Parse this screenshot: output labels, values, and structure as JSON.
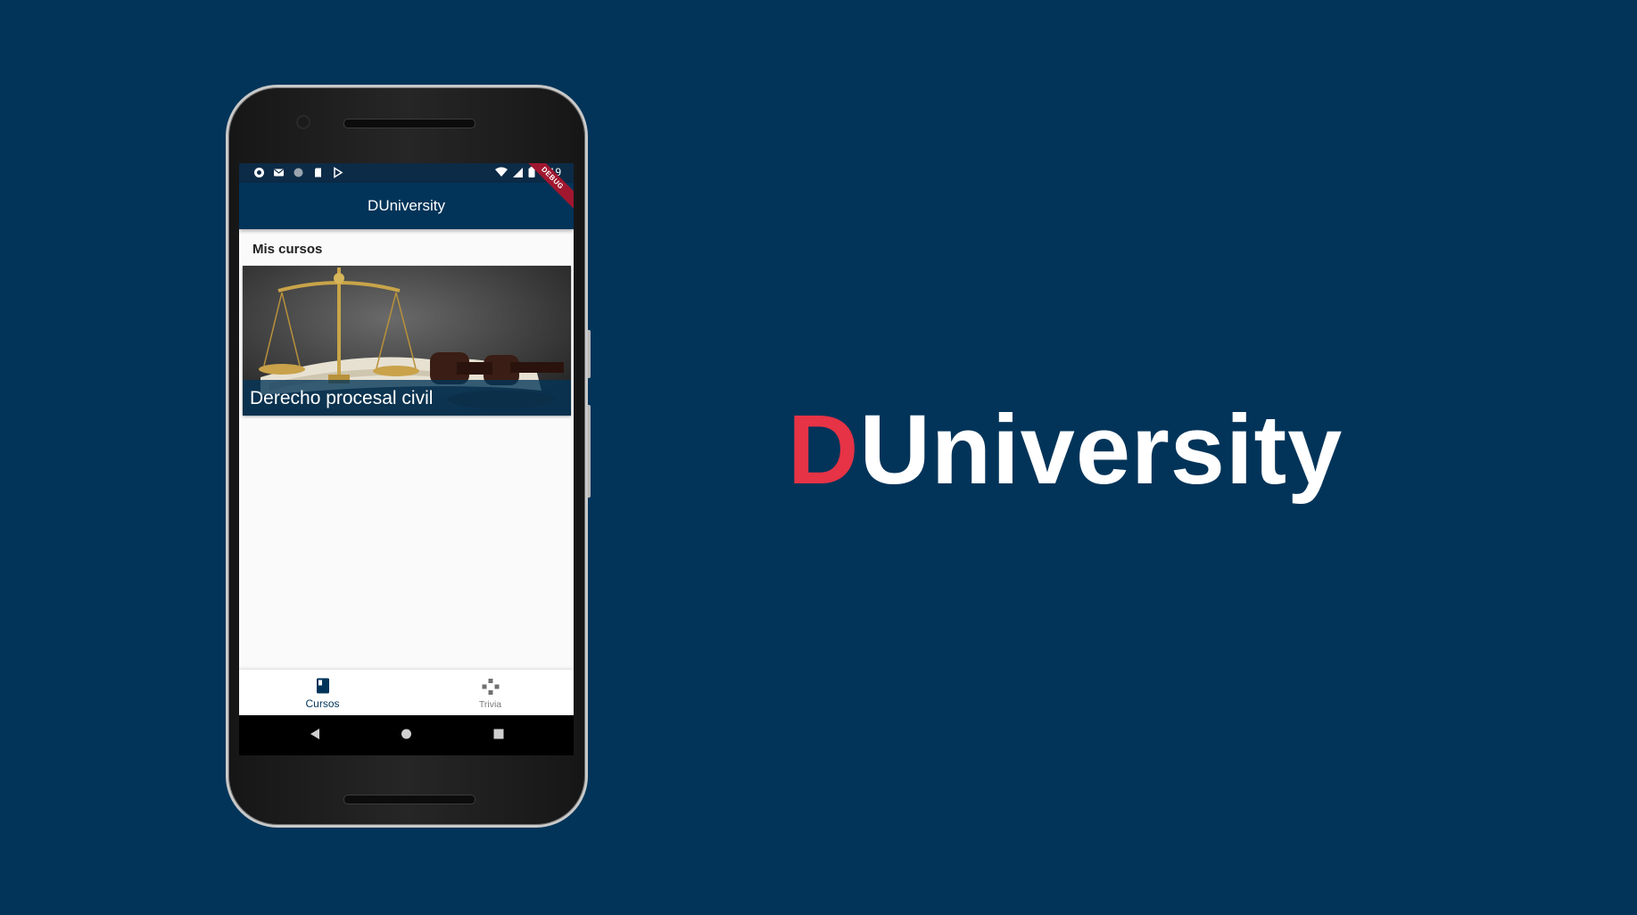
{
  "brand": {
    "first_letter": "D",
    "rest": "University"
  },
  "phone": {
    "status_bar": {
      "time": "9:19"
    },
    "debug_ribbon": "DEBUG",
    "app_bar": {
      "title": "DUniversity"
    },
    "section_title": "Mis cursos",
    "courses": [
      {
        "title": "Derecho procesal civil"
      }
    ],
    "bottom_nav": {
      "items": [
        {
          "label": "Cursos",
          "active": true,
          "icon": "book-icon"
        },
        {
          "label": "Trivia",
          "active": false,
          "icon": "gamepad-icon"
        }
      ]
    },
    "system_nav": [
      "back-icon",
      "home-icon",
      "recents-icon"
    ]
  },
  "colors": {
    "background": "#023459",
    "brand_accent": "#e63346",
    "app_bar": "#023459"
  }
}
